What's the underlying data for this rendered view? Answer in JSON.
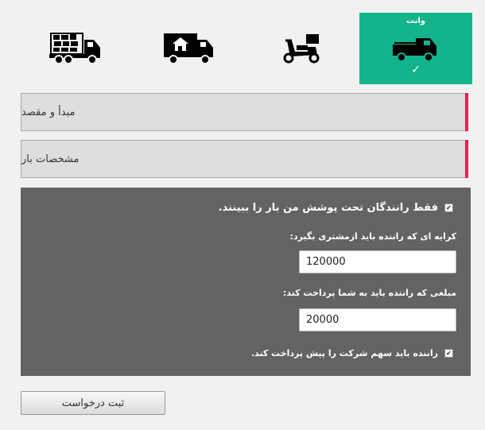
{
  "vehicles": [
    {
      "label": "",
      "icon": "cargo-truck-icon",
      "selected": false
    },
    {
      "label": "",
      "icon": "box-truck-icon",
      "selected": false
    },
    {
      "label": "",
      "icon": "motorcycle-delivery-icon",
      "selected": false
    },
    {
      "label": "وانت",
      "icon": "pickup-truck-icon",
      "selected": true,
      "check": "✓"
    }
  ],
  "sections": {
    "origin_destination": "مبدأ و مقصد",
    "cargo_details": "مشخصات بار"
  },
  "options": {
    "covered_drivers_only": {
      "label": "فقط رانندگان تحت پوشش من بار را ببینند.",
      "checked": true
    },
    "fare_label": "کرایه ای که راننده باید ازمشتری بگیرد:",
    "fare_value": "120000",
    "pay_label": "مبلغی که راننده باید به شما پرداخت کند:",
    "pay_value": "20000",
    "prepay_share": {
      "label": "راننده باید سهم شرکت را پیش پرداخت کند.",
      "checked": true
    }
  },
  "submit_label": "ثبت درخواست",
  "colors": {
    "selected": "#13b38b",
    "accent": "#ed1f55",
    "panel": "#636363"
  }
}
